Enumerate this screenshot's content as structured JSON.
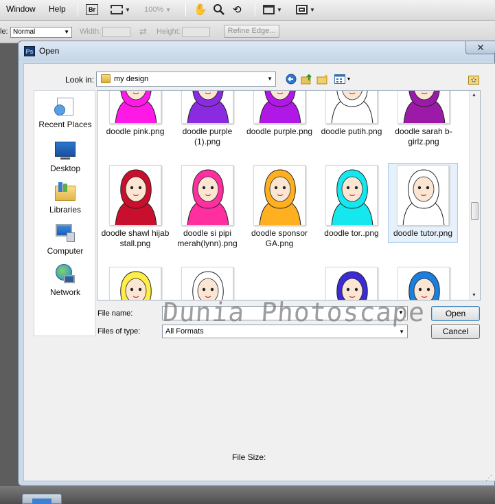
{
  "menubar": {
    "window_label": "Window",
    "help_label": "Help",
    "bridge_label": "Br",
    "zoom_value": "100%"
  },
  "options_bar": {
    "mode_label": "le:",
    "mode_value": "Normal",
    "width_label": "Width:",
    "height_label": "Height:",
    "refine_label": "Refine Edge..."
  },
  "dialog": {
    "title": "Open",
    "close_glyph": "✕",
    "lookin_label": "Look in:",
    "lookin_value": "my design",
    "places": [
      {
        "label": "Recent Places",
        "icon": "recent-places-icon"
      },
      {
        "label": "Desktop",
        "icon": "desktop-icon"
      },
      {
        "label": "Libraries",
        "icon": "libraries-icon"
      },
      {
        "label": "Computer",
        "icon": "computer-icon"
      },
      {
        "label": "Network",
        "icon": "network-icon"
      }
    ],
    "files_row1": [
      {
        "name": "doodle pink.png",
        "color": "#ff19e6"
      },
      {
        "name": "doodle purple (1).png",
        "color": "#8a2be2"
      },
      {
        "name": "doodle purple.png",
        "color": "#b018e8"
      },
      {
        "name": "doodle putih.png",
        "color": "#ffffff"
      },
      {
        "name": "doodle sarah b-girlz.png",
        "color": "#9c1aa8"
      }
    ],
    "files_row2": [
      {
        "name": "doodle shawl hijab stall.png",
        "color": "#c8102e"
      },
      {
        "name": "doodle si pipi merah(lynn).png",
        "color": "#ff2fa0"
      },
      {
        "name": "doodle sponsor GA.png",
        "color": "#ffb020"
      },
      {
        "name": "doodle tor..png",
        "color": "#14e8ee"
      },
      {
        "name": "doodle tutor.png",
        "color": "#ffffff"
      }
    ],
    "files_row3_colors": [
      "#ffee44",
      "#ffffff",
      "#3b2bd6",
      "#1b7fe0"
    ],
    "file_name_label": "File name:",
    "file_name_value": "",
    "file_type_label": "Files of type:",
    "file_type_value": "All Formats",
    "open_label": "Open",
    "cancel_label": "Cancel",
    "file_size_label": "File Size:",
    "watermark": "Dunia Photoscape"
  }
}
